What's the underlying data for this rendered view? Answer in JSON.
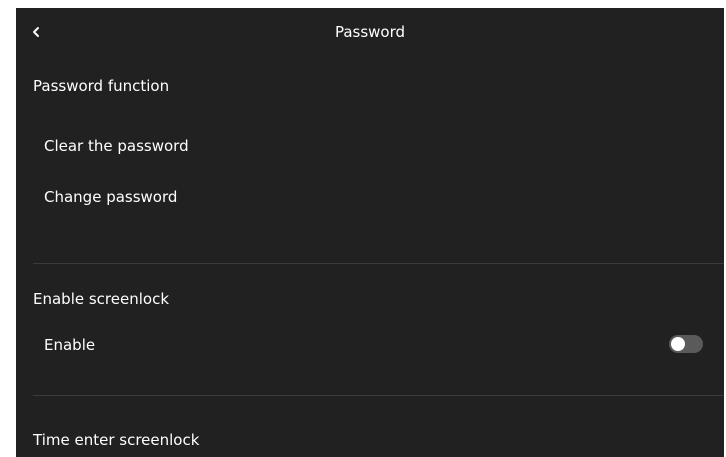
{
  "header": {
    "title": "Password",
    "back_icon": "chevron-left-icon"
  },
  "sections": {
    "password_function": {
      "title": "Password function",
      "items": [
        "Clear the password",
        "Change password"
      ]
    },
    "screenlock": {
      "title": "Enable screenlock",
      "enable_label": "Enable",
      "enable_on": false
    },
    "time_screenlock": {
      "title": "Time enter screenlock"
    }
  },
  "colors": {
    "background": "#212121",
    "text": "#ffffff",
    "divider": "#3b3b3b",
    "toggle_off": "#5a5a5a"
  }
}
